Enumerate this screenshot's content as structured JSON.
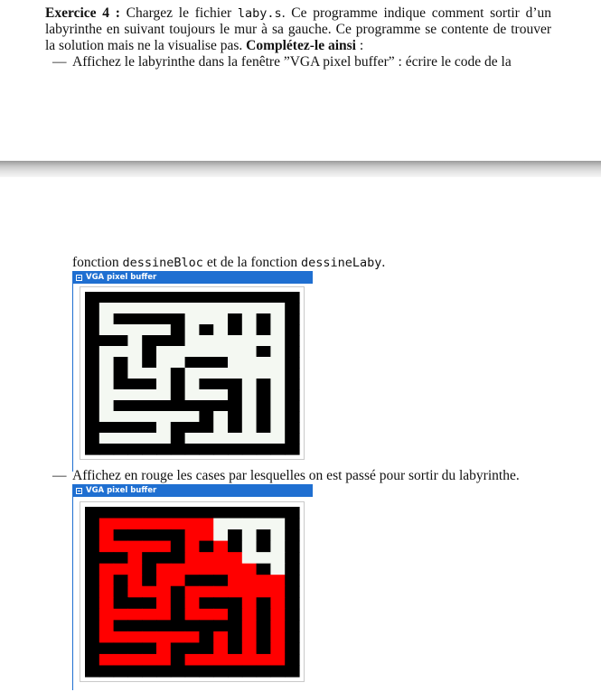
{
  "exercise": {
    "title": "Exercice 4 :",
    "line1_a": " Chargez le fichier ",
    "file": "laby.s",
    "line1_b": ". Ce programme indique comment sortir d’un",
    "line2": "labyrinthe en suivant toujours le mur à sa gauche. Ce programme se contente de trouver",
    "line3_a": "la solution mais ne la visualise pas. ",
    "line3_bold": "Complétez-le ainsi",
    "line3_b": " :"
  },
  "bullet1": {
    "dash": "—",
    "line1": "Affichez le labyrinthe dans la fenêtre ”VGA pixel buffer” : écrire le code de la",
    "line2_a": "fonction ",
    "fn1": "dessineBloc",
    "line2_b": " et de la fonction ",
    "fn2": "dessineLaby",
    "line2_c": "."
  },
  "bullet2": {
    "dash": "—",
    "text": "Affichez en rouge les cases par lesquelles on est passé pour sortir du labyrinthe."
  },
  "vga1": {
    "title": "VGA pixel buffer"
  },
  "vga2": {
    "title": "VGA pixel buffer"
  },
  "colors": {
    "wall": "#000000",
    "open": "#f4f8f2",
    "path": "#ff0000",
    "titlebar": "#1f6fd1"
  },
  "maze": {
    "grid": [
      "###############",
      "#.............#",
      "#.#####...#.#.#",
      "#.....#.#.#.#.#",
      "###.###.......#",
      "#...#.......#.#",
      "#.#.#..###....#",
      "#.#...#.......#",
      "#.###.#.###.#.#",
      "#.....#...#.#.#",
      "#.#########.#.#",
      "#.......#.#.#.#",
      "#####.###.#.#.#",
      "#.....#.......#",
      "###############"
    ],
    "solved_grid": [
      "###############",
      "#RRRRRRRR.....#",
      "#R#####RR.#.#.#",
      "#RRRRR#R#R#.#.#",
      "###R###RRRR...#",
      "#RRR#RRRRRRR#.#",
      "#R#R#RR###RRRR#",
      "#R#RRR#RRRRRRR#",
      "#R###R#R###R#R#",
      "#RRRRR#RRR#R#R#",
      "#R#########R#R#",
      "#RRRRRRR#R#R#R#",
      "#####R###R#R#R#",
      "#RRRRR#RRRRRRR#",
      "###############"
    ]
  }
}
